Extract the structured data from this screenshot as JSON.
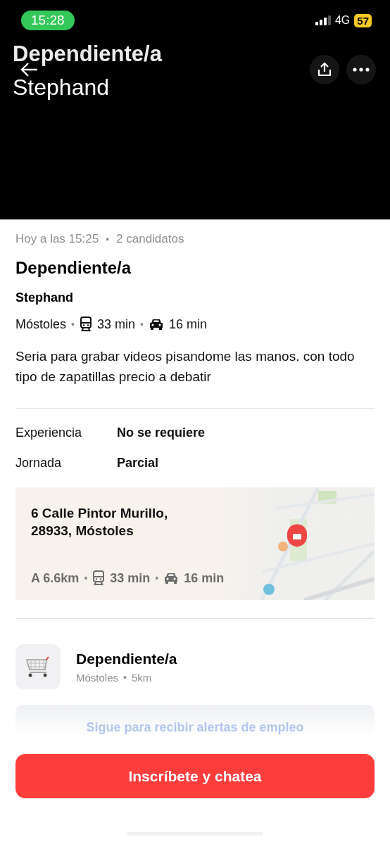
{
  "status_bar": {
    "time": "15:28",
    "network": "4G",
    "battery": "57"
  },
  "header": {
    "title": "Dependiente/a",
    "subtitle": "Stephand"
  },
  "meta": {
    "posted": "Hoy a las 15:25",
    "separator": "•",
    "candidates": "2 candidatos"
  },
  "job": {
    "title": "Dependiente/a",
    "company": "Stephand",
    "city": "Móstoles",
    "separators": [
      "•",
      "•"
    ],
    "transit": "33 min",
    "drive": "16 min",
    "description": "Seria para grabar videos pisandome las manos. con todo tipo de zapatillas precio a debatir"
  },
  "details": [
    {
      "label": "Experiencia",
      "value": "No se requiere"
    },
    {
      "label": "Jornada",
      "value": "Parcial"
    }
  ],
  "location": {
    "address_line_1": "6 Calle Pintor Murillo,",
    "address_line_2": "28933, Móstoles",
    "distance": "A 6.6km",
    "separators": [
      "•",
      "•"
    ],
    "transit": "33 min",
    "drive": "16 min"
  },
  "similar": {
    "title": "Dependiente/a",
    "city": "Móstoles",
    "separator": "•",
    "distance": "5km"
  },
  "follow_banner": "Sigue para recibir alertas de empleo",
  "cta": "Inscríbete y chatea"
}
